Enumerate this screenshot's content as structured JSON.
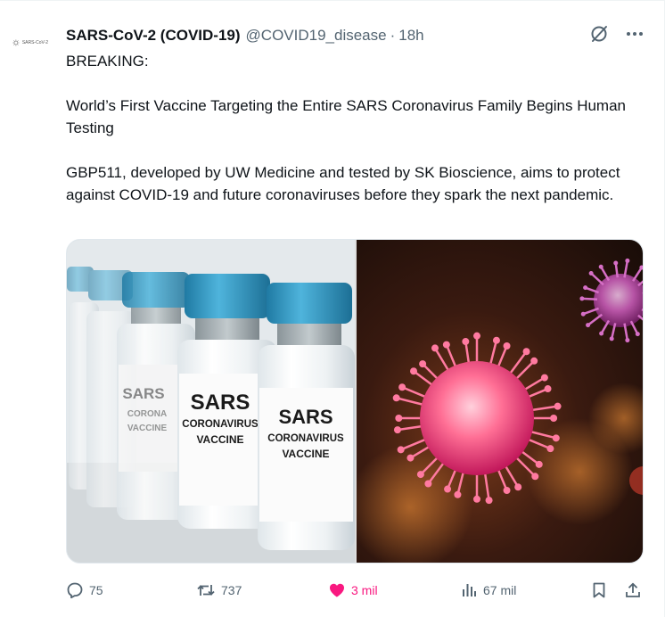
{
  "tweet": {
    "avatar_text": "SARS-CoV-2",
    "display_name": "SARS-CoV-2 (COVID-19)",
    "handle": "@COVID19_disease",
    "separator": "·",
    "time": "18h",
    "body": {
      "line1": "BREAKING:",
      "line2": "World’s First Vaccine Targeting the Entire SARS Coronavirus Family Begins Human Testing",
      "line3": "GBP511, developed by UW Medicine and tested by SK Bioscience, aims to protect against COVID-19 and future coronaviruses before they spark the next pandemic."
    },
    "media": {
      "vial_front_1": [
        "SARS",
        "CORONAVIRUS",
        "VACCINE"
      ],
      "vial_front_2": [
        "SARS",
        "CORONAVIRUS",
        "VACCINE"
      ],
      "vial_back": [
        "SARS",
        "CORONA",
        "VACCINE"
      ]
    },
    "actions": {
      "replies": "75",
      "reposts": "737",
      "likes": "3 mil",
      "views": "67 mil"
    }
  },
  "colors": {
    "text": "#0f1419",
    "secondary": "#536471",
    "like": "#f91880",
    "vial_cap": "#3a9ec4"
  },
  "icons": {
    "header": [
      "grok-slash-icon",
      "more-icon"
    ],
    "actions": [
      "reply-icon",
      "repost-icon",
      "heart-filled-icon",
      "views-icon",
      "bookmark-icon",
      "share-icon"
    ]
  }
}
